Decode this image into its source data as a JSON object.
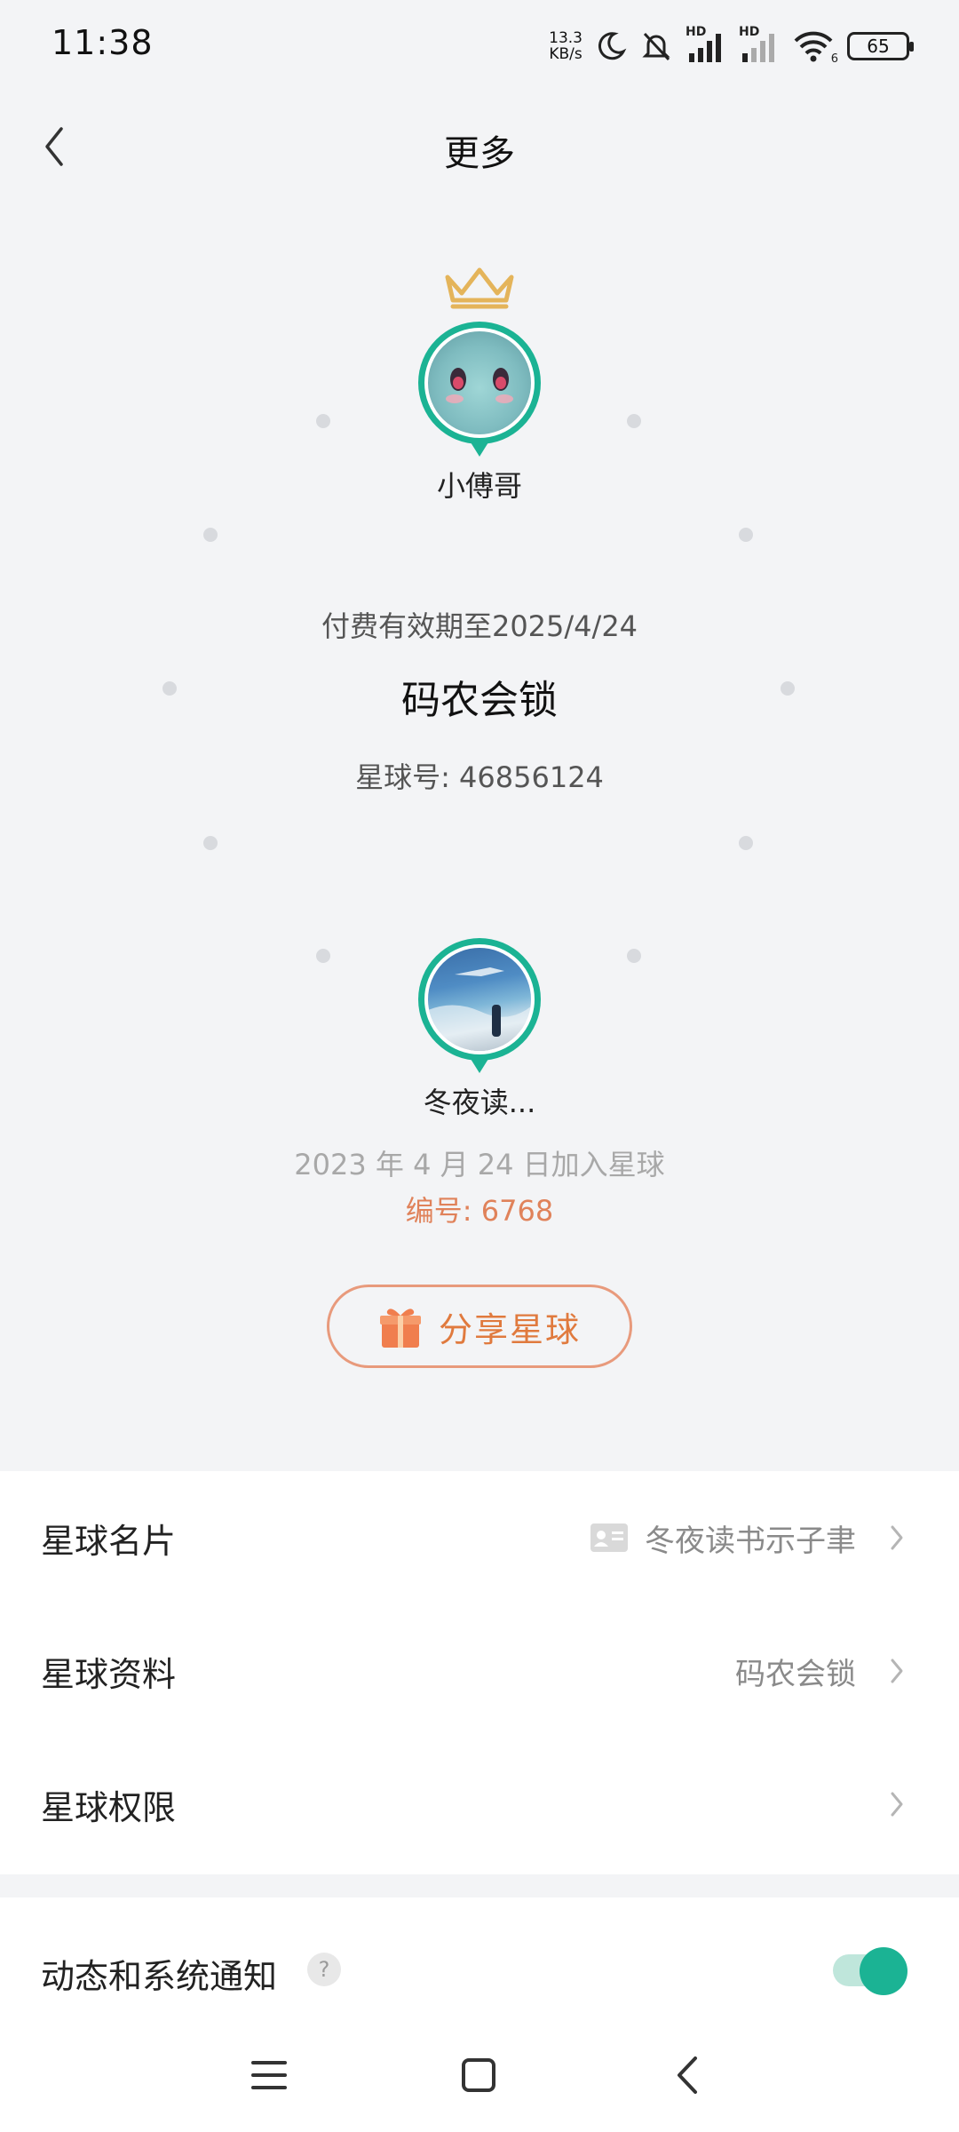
{
  "status_bar": {
    "time": "11:38",
    "net_speed_value": "13.3",
    "net_speed_unit": "KB/s",
    "signal_label_1": "HD",
    "signal_label_2": "HD",
    "wifi_badge": "6",
    "battery": "65"
  },
  "header": {
    "title": "更多"
  },
  "hero": {
    "owner_name": "小傅哥",
    "expiry_text": "付费有效期至2025/4/24",
    "group_name": "码农会锁",
    "group_number": "星球号: 46856124",
    "member_name": "冬夜读...",
    "join_date": "2023 年 4 月 24 日加入星球",
    "member_number": "编号: 6768",
    "share_label": "分享星球",
    "accent_color": "#1bb394",
    "share_color": "#e07a3e"
  },
  "list": {
    "rows": [
      {
        "label": "星球名片",
        "value": "冬夜读书示子聿",
        "icon": "card-icon"
      },
      {
        "label": "星球资料",
        "value": "码农会锁"
      },
      {
        "label": "星球权限",
        "value": ""
      }
    ]
  },
  "notify": {
    "label": "动态和系统通知",
    "help": "?",
    "enabled": true
  },
  "nav_bar": {
    "items": [
      "menu-icon",
      "home-icon",
      "back-icon"
    ]
  }
}
